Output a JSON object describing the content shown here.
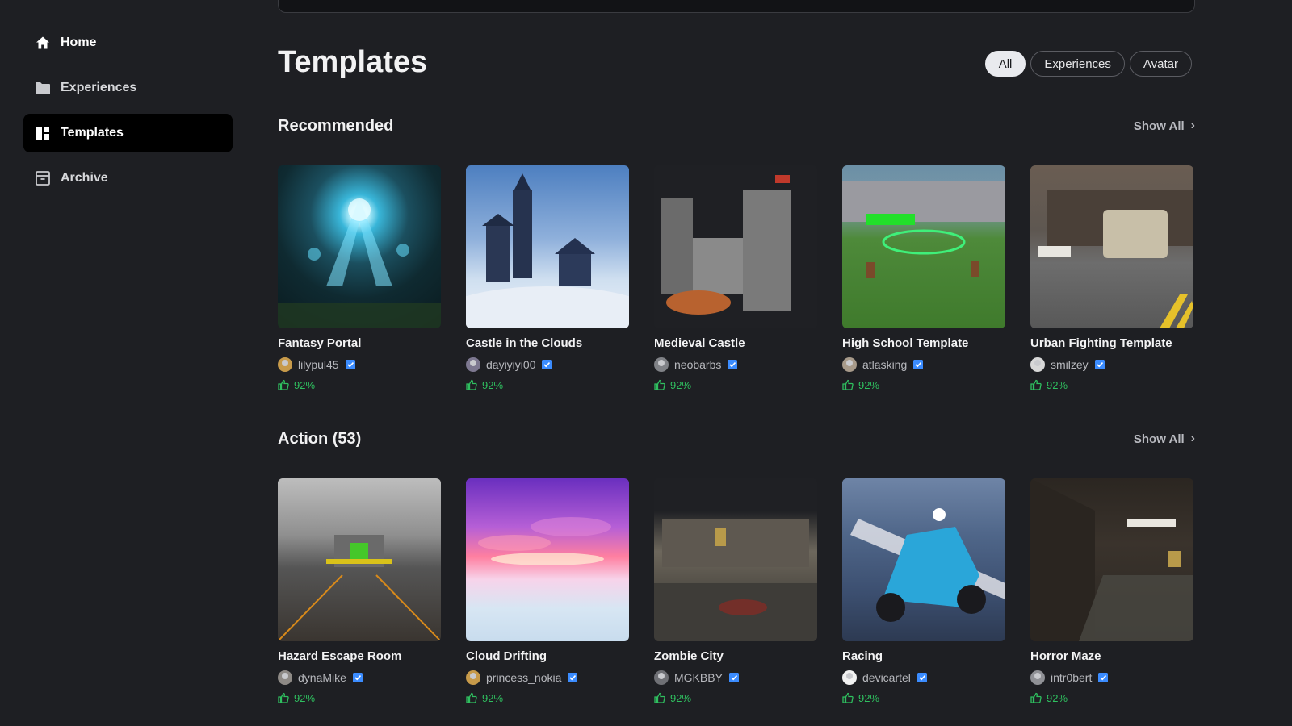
{
  "sidebar": {
    "items": [
      {
        "label": "Home",
        "icon": "home-icon"
      },
      {
        "label": "Experiences",
        "icon": "folder-icon"
      },
      {
        "label": "Templates",
        "icon": "grid-icon",
        "active": true
      },
      {
        "label": "Archive",
        "icon": "archive-icon"
      }
    ]
  },
  "page": {
    "title": "Templates",
    "filters": [
      {
        "label": "All",
        "selected": true
      },
      {
        "label": "Experiences",
        "selected": false
      },
      {
        "label": "Avatar",
        "selected": false
      }
    ]
  },
  "sections": [
    {
      "title": "Recommended",
      "show_all": "Show All",
      "cards": [
        {
          "title": "Fantasy Portal",
          "creator": "lilypul45",
          "rating": "92%"
        },
        {
          "title": "Castle in the Clouds",
          "creator": "dayiyiyi00",
          "rating": "92%"
        },
        {
          "title": "Medieval Castle",
          "creator": "neobarbs",
          "rating": "92%"
        },
        {
          "title": "High School Template",
          "creator": "atlasking",
          "rating": "92%"
        },
        {
          "title": "Urban Fighting Template",
          "creator": "smilzey",
          "rating": "92%"
        }
      ]
    },
    {
      "title": "Action (53)",
      "show_all": "Show All",
      "cards": [
        {
          "title": "Hazard Escape Room",
          "creator": "dynaMike",
          "rating": "92%"
        },
        {
          "title": "Cloud Drifting",
          "creator": "princess_nokia",
          "rating": "92%"
        },
        {
          "title": "Zombie City",
          "creator": "MGKBBY",
          "rating": "92%"
        },
        {
          "title": "Racing",
          "creator": "devicartel",
          "rating": "92%"
        },
        {
          "title": "Horror Maze",
          "creator": "intr0bert",
          "rating": "92%"
        }
      ]
    }
  ],
  "colors": {
    "background": "#1e1f23",
    "active_nav": "#000000",
    "rating_green": "#2fbf5f",
    "verified_blue": "#3b8cff"
  }
}
